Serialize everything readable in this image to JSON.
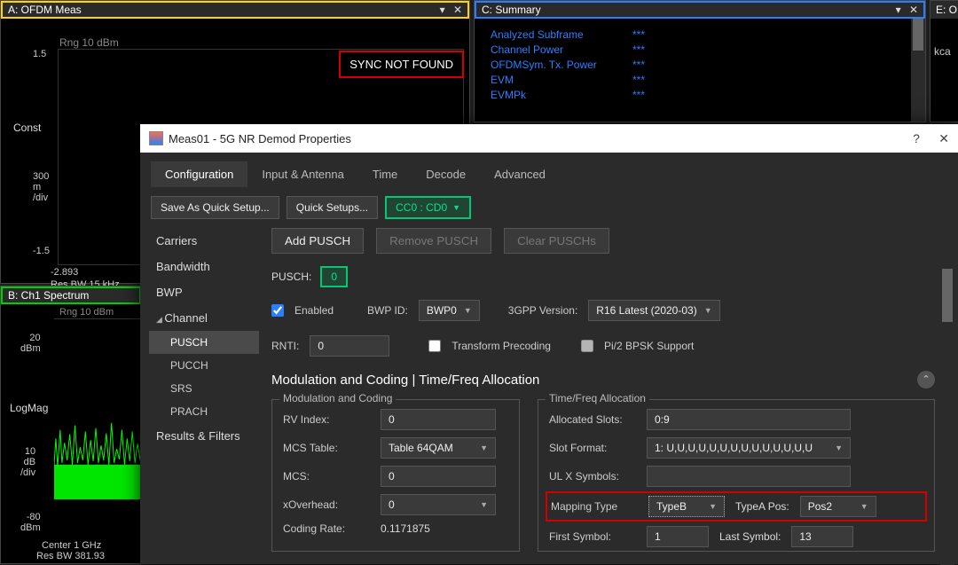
{
  "panelA": {
    "title": "A: OFDM Meas",
    "rng": "Rng 10 dBm",
    "y_top": "1.5",
    "const": "Const",
    "y_mid": "300\nm\n/div",
    "y_bot": "-1.5",
    "foot_left": "-2.893",
    "foot_res": "Res BW 15 kHz",
    "sync": "SYNC NOT FOUND"
  },
  "panelB": {
    "title": "B: Ch1 Spectrum",
    "rng": "Rng 10 dBm",
    "y_top": "20\ndBm",
    "logmag": "LogMag",
    "y_mid": "10\ndB\n/div",
    "y_bot": "-80\ndBm",
    "foot_center": "Center 1 GHz",
    "foot_res": "Res BW 381.93"
  },
  "panelC": {
    "title": "C: Summary",
    "metrics": [
      {
        "name": "Analyzed Subframe",
        "val": "***"
      },
      {
        "name": "Channel Power",
        "val": "***"
      },
      {
        "name": "OFDMSym. Tx. Power",
        "val": "***"
      },
      {
        "name": "EVM",
        "val": "***"
      },
      {
        "name": "EVMPk",
        "val": "***"
      }
    ]
  },
  "panelE": {
    "title": "E: O",
    "body": "kca"
  },
  "dialog": {
    "title": "Meas01 - 5G NR Demod Properties",
    "tabs": [
      "Configuration",
      "Input & Antenna",
      "Time",
      "Decode",
      "Advanced"
    ],
    "saveQuick": "Save As Quick Setup...",
    "quickSetups": "Quick Setups...",
    "ccLabel": "CC0 : CD0",
    "side": {
      "carriers": "Carriers",
      "bandwidth": "Bandwidth",
      "bwp": "BWP",
      "channel": "Channel",
      "pusch": "PUSCH",
      "pucch": "PUCCH",
      "srs": "SRS",
      "prach": "PRACH",
      "results": "Results & Filters"
    },
    "buttons": {
      "add": "Add PUSCH",
      "remove": "Remove PUSCH",
      "clear": "Clear PUSCHs"
    },
    "pusch": {
      "label": "PUSCH:",
      "value": "0"
    },
    "enabled": {
      "label": "Enabled",
      "checked": true
    },
    "bwpid": {
      "label": "BWP ID:",
      "value": "BWP0"
    },
    "gpp": {
      "label": "3GPP Version:",
      "value": "R16 Latest (2020-03)"
    },
    "rnti": {
      "label": "RNTI:",
      "value": "0"
    },
    "transform": {
      "label": "Transform Precoding",
      "checked": false
    },
    "bpsk": {
      "label": "Pi/2 BPSK Support"
    },
    "sectionTitle": "Modulation and Coding | Time/Freq Allocation",
    "modcod": {
      "legend": "Modulation and Coding",
      "rvIndex": {
        "label": "RV Index:",
        "value": "0"
      },
      "mcsTable": {
        "label": "MCS Table:",
        "value": "Table 64QAM"
      },
      "mcs": {
        "label": "MCS:",
        "value": "0"
      },
      "xOverhead": {
        "label": "xOverhead:",
        "value": "0"
      },
      "codingRate": {
        "label": "Coding Rate:",
        "value": "0.1171875"
      }
    },
    "tfalloc": {
      "legend": "Time/Freq Allocation",
      "allocSlots": {
        "label": "Allocated Slots:",
        "value": "0:9"
      },
      "slotFormat": {
        "label": "Slot Format:",
        "value": "1: U,U,U,U,U,U,U,U,U,U,U,U,U,U"
      },
      "ulx": {
        "label": "UL X Symbols:",
        "value": ""
      },
      "mapType": {
        "label": "Mapping Type",
        "value": "TypeB"
      },
      "typeAPos": {
        "label": "TypeA Pos:",
        "value": "Pos2"
      },
      "firstSym": {
        "label": "First Symbol:",
        "value": "1"
      },
      "lastSym": {
        "label": "Last Symbol:",
        "value": "13"
      }
    }
  }
}
